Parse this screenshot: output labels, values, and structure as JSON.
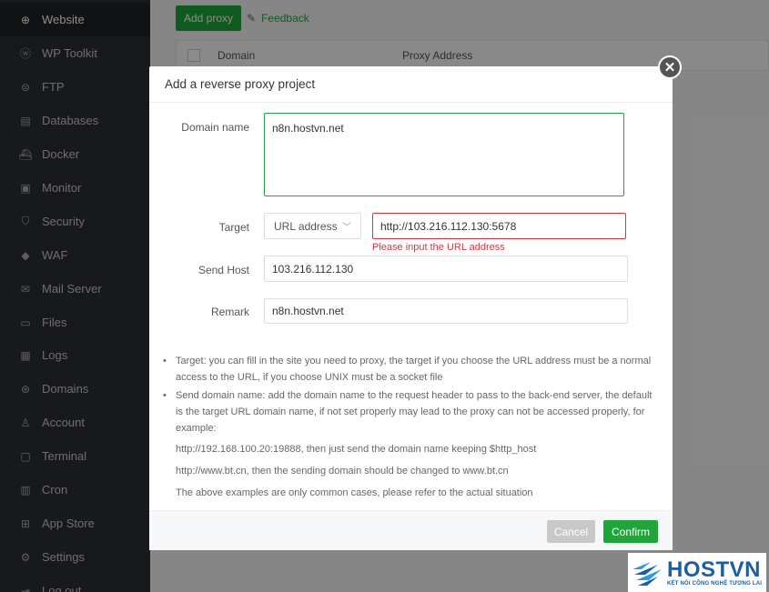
{
  "sidebar": {
    "items": [
      {
        "label": "Website",
        "icon": "globe-icon",
        "glyph": "⊕",
        "active": true
      },
      {
        "label": "WP Toolkit",
        "icon": "wordpress-icon",
        "glyph": "ⓦ"
      },
      {
        "label": "FTP",
        "icon": "ftp-globe-icon",
        "glyph": "⊜"
      },
      {
        "label": "Databases",
        "icon": "database-icon",
        "glyph": "▤"
      },
      {
        "label": "Docker",
        "icon": "docker-icon",
        "glyph": "⛴"
      },
      {
        "label": "Monitor",
        "icon": "monitor-icon",
        "glyph": "▣"
      },
      {
        "label": "Security",
        "icon": "shield-icon",
        "glyph": "⛉"
      },
      {
        "label": "WAF",
        "icon": "waf-shield-icon",
        "glyph": "◆"
      },
      {
        "label": "Mail Server",
        "icon": "mail-icon",
        "glyph": "✉"
      },
      {
        "label": "Files",
        "icon": "folder-icon",
        "glyph": "▭"
      },
      {
        "label": "Logs",
        "icon": "logs-icon",
        "glyph": "▦"
      },
      {
        "label": "Domains",
        "icon": "domains-icon",
        "glyph": "⊛"
      },
      {
        "label": "Account",
        "icon": "user-icon",
        "glyph": "♙"
      },
      {
        "label": "Terminal",
        "icon": "terminal-icon",
        "glyph": "▢"
      },
      {
        "label": "Cron",
        "icon": "calendar-icon",
        "glyph": "▥"
      },
      {
        "label": "App Store",
        "icon": "grid-icon",
        "glyph": "⊞"
      },
      {
        "label": "Settings",
        "icon": "gear-icon",
        "glyph": "⚙"
      },
      {
        "label": "Log out",
        "icon": "logout-icon",
        "glyph": "⇥"
      }
    ]
  },
  "toolbar": {
    "add_proxy_label": "Add proxy",
    "feedback_label": "Feedback"
  },
  "table": {
    "columns": [
      "Domain",
      "Proxy Address"
    ]
  },
  "dialog": {
    "title": "Add a reverse proxy project",
    "domain_label": "Domain name",
    "domain_value": "n8n.hostvn.net",
    "target_label": "Target",
    "target_type": "URL address",
    "target_value": "http://103.216.112.130:5678",
    "target_error": "Please input the URL address",
    "send_host_label": "Send Host",
    "send_host_value": "103.216.112.130",
    "remark_label": "Remark",
    "remark_value": "n8n.hostvn.net",
    "notes": {
      "target_note": "Target: you can fill in the site you need to proxy, the target if you choose the URL address must be a normal access to the URL, if you choose UNIX must be a socket file",
      "send_domain_note": "Send domain name: add the domain name to the request header to pass to the back-end server, the default is the target URL domain name, if not set properly may lead to the proxy can not be accessed properly, for example:",
      "example1": "http://192.168.100.20:19888, then just send the domain name keeping $http_host",
      "example2": "http://www.bt.cn, then the sending domain should be changed to www.bt.cn",
      "example3": "The above examples are only common cases, please refer to the actual situation"
    },
    "cancel_label": "Cancel",
    "confirm_label": "Confirm"
  },
  "logo": {
    "name": "HOSTVN",
    "tagline": "KẾT NỐI CÔNG NGHỆ TƯƠNG LAI"
  },
  "colors": {
    "accent": "#20a53a",
    "error": "#e0303a",
    "sidebar_bg": "#2c2f33",
    "logo_blue": "#1a5ea8"
  }
}
